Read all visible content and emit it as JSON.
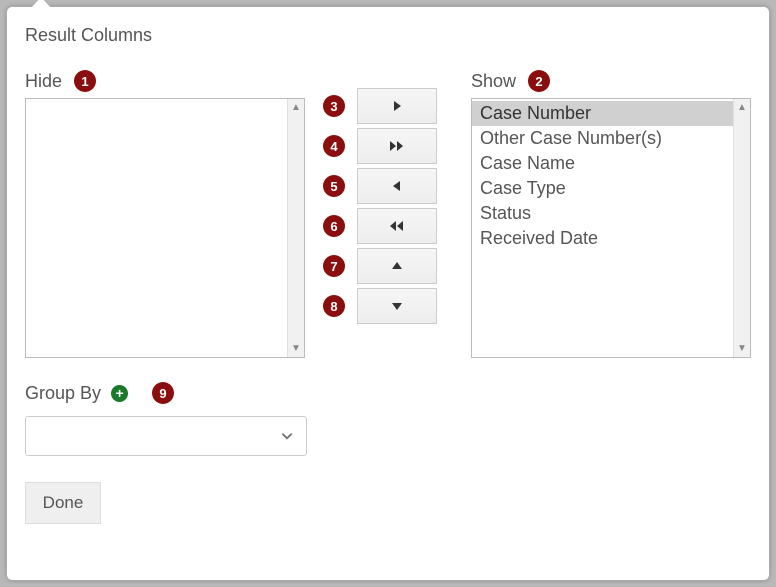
{
  "title": "Result Columns",
  "hide": {
    "label": "Hide",
    "callout": "1",
    "items": []
  },
  "show": {
    "label": "Show",
    "callout": "2",
    "items": [
      {
        "label": "Case Number",
        "selected": true
      },
      {
        "label": "Other Case Number(s)",
        "selected": false
      },
      {
        "label": "Case Name",
        "selected": false
      },
      {
        "label": "Case Type",
        "selected": false
      },
      {
        "label": "Status",
        "selected": false
      },
      {
        "label": "Received Date",
        "selected": false
      }
    ]
  },
  "movers": [
    {
      "callout": "3",
      "name": "move-right-button"
    },
    {
      "callout": "4",
      "name": "move-all-right-button"
    },
    {
      "callout": "5",
      "name": "move-left-button"
    },
    {
      "callout": "6",
      "name": "move-all-left-button"
    },
    {
      "callout": "7",
      "name": "move-up-button"
    },
    {
      "callout": "8",
      "name": "move-down-button"
    }
  ],
  "groupBy": {
    "label": "Group By",
    "callout": "9",
    "selected": ""
  },
  "done": {
    "label": "Done"
  }
}
